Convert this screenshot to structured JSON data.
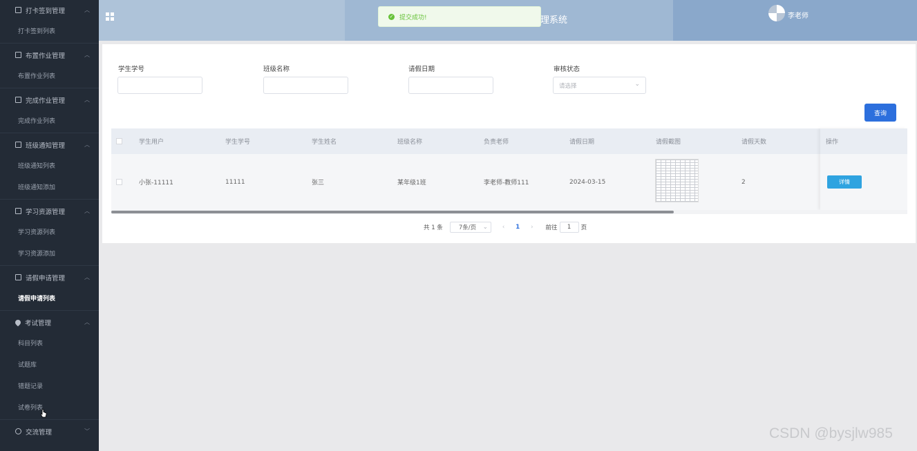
{
  "sidebar": {
    "groups": [
      {
        "title": "打卡签到管理",
        "icon": "checkin-icon",
        "items": [
          "打卡签到列表"
        ]
      },
      {
        "title": "布置作业管理",
        "icon": "assign-icon",
        "items": [
          "布置作业列表"
        ]
      },
      {
        "title": "完成作业管理",
        "icon": "complete-icon",
        "items": [
          "完成作业列表"
        ]
      },
      {
        "title": "班级通知管理",
        "icon": "notice-icon",
        "items": [
          "班级通知列表",
          "班级通知添加"
        ]
      },
      {
        "title": "学习资源管理",
        "icon": "resource-icon",
        "items": [
          "学习资源列表",
          "学习资源添加"
        ]
      },
      {
        "title": "请假申请管理",
        "icon": "leave-icon",
        "items": [
          "请假申请列表"
        ]
      },
      {
        "title": "考试管理",
        "icon": "location-pin-icon",
        "items": [
          "科目列表",
          "试题库",
          "错题记录",
          "试卷列表"
        ]
      },
      {
        "title": "交流管理",
        "icon": "chat-icon",
        "items": []
      }
    ],
    "active_item": "请假申请列表"
  },
  "header": {
    "title": "理系统",
    "user": "李老师"
  },
  "toast": {
    "message": "提交成功!"
  },
  "filters": {
    "student_no_label": "学生学号",
    "class_name_label": "班级名称",
    "leave_date_label": "请假日期",
    "status_label": "审核状态",
    "status_placeholder": "请选择",
    "query_button": "查询"
  },
  "table": {
    "columns": [
      "学生用户",
      "学生学号",
      "学生姓名",
      "班级名称",
      "负责老师",
      "请假日期",
      "请假截图",
      "请假天数",
      "操作"
    ],
    "rows": [
      {
        "user": "小张-11111",
        "student_no": "11111",
        "name": "张三",
        "class_name": "某年级1班",
        "teacher": "李老师-教师111",
        "date": "2024-03-15",
        "days": "2",
        "action": "详情"
      }
    ]
  },
  "pagination": {
    "total": "共 1 条",
    "page_size": "7条/页",
    "current_page": "1",
    "goto_label": "前往",
    "goto_value": "1",
    "page_suffix": "页"
  },
  "watermark": "CSDN @bysjlw985",
  "colors": {
    "sidebar_bg": "#232b36",
    "primary": "#2c6fdd",
    "success": "#67c23a",
    "detail_button": "#2fa3e0"
  }
}
